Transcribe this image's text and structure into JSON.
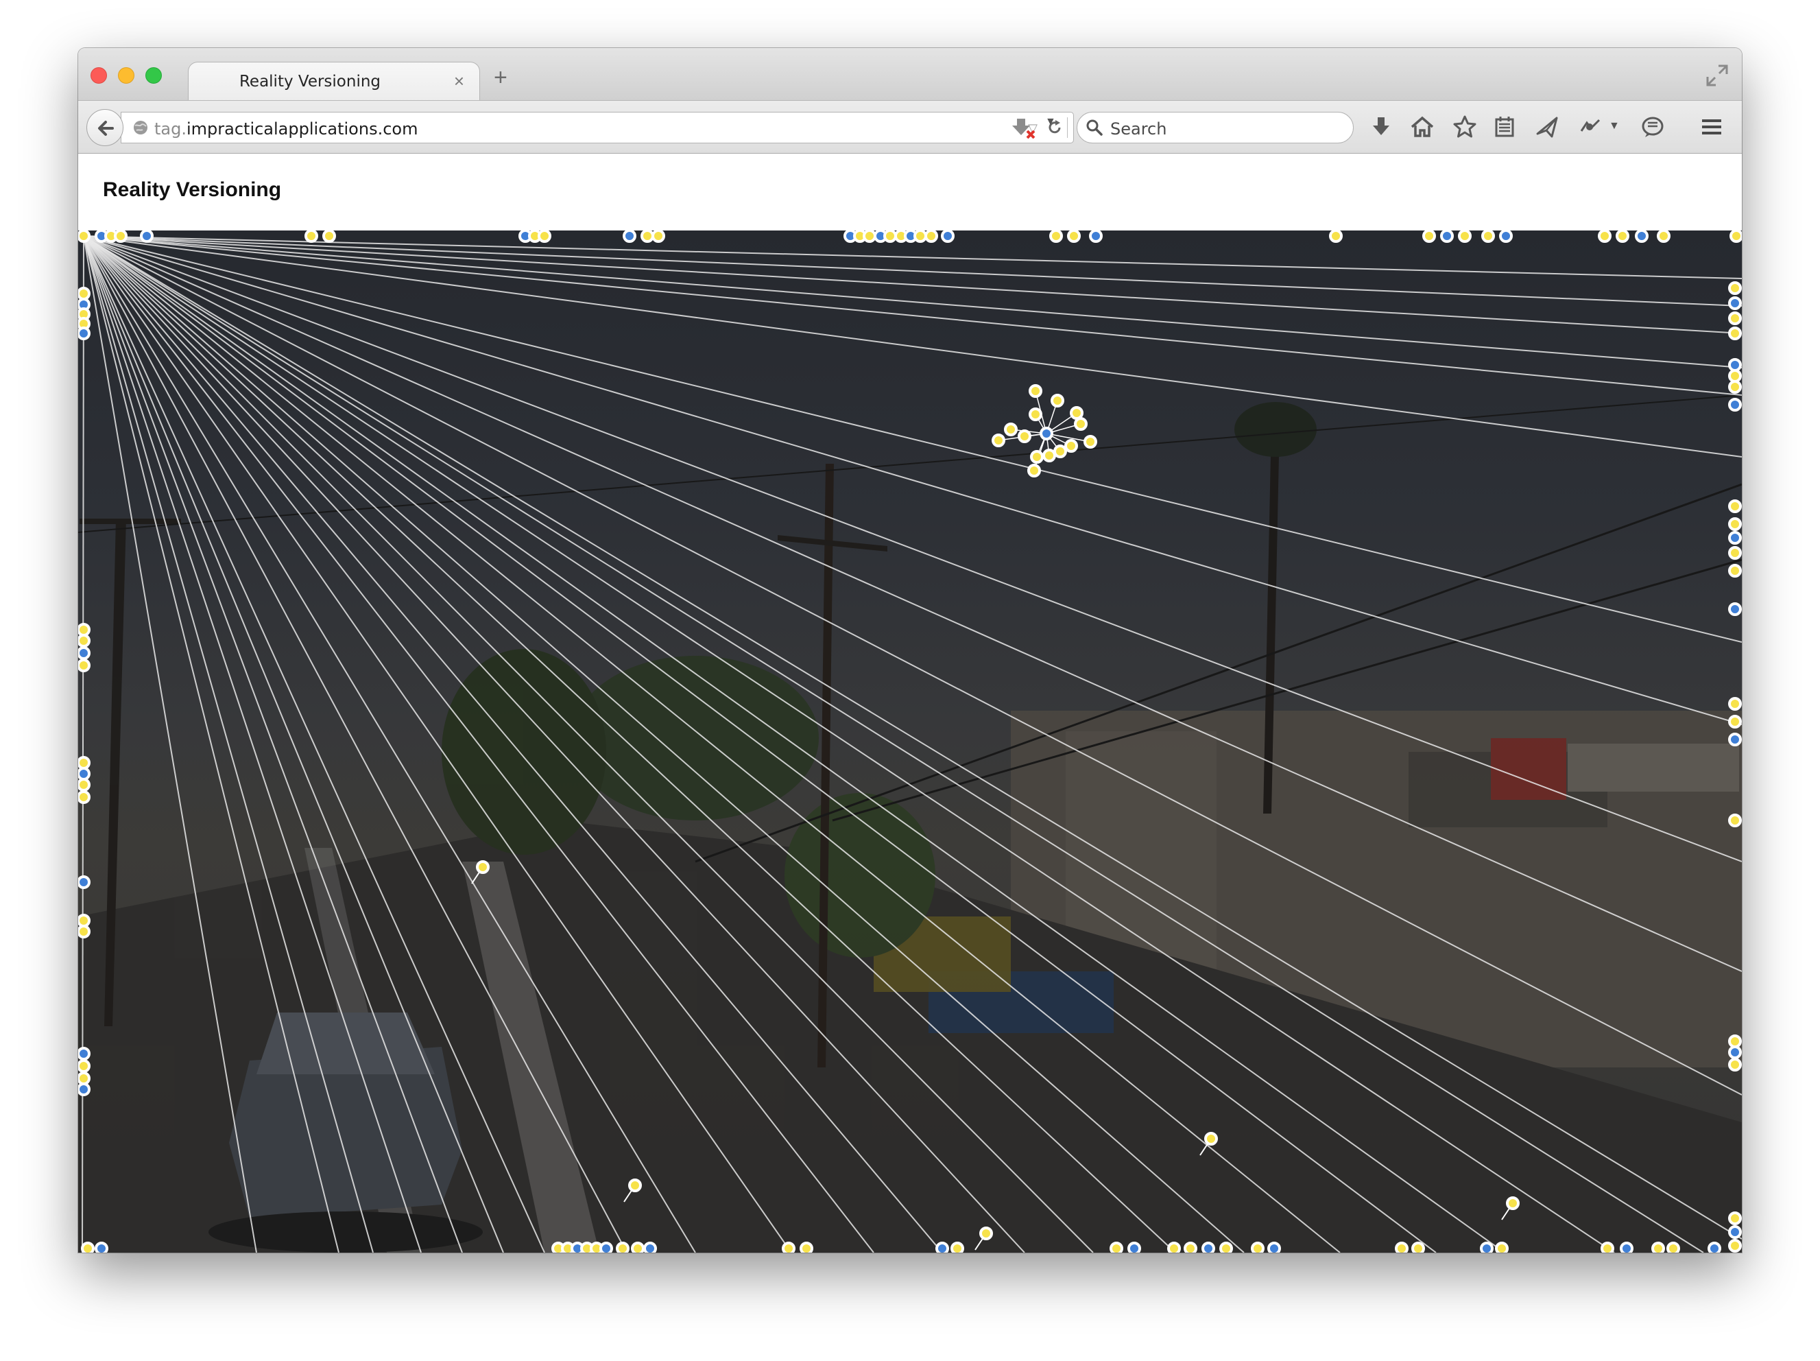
{
  "browser": {
    "tab_title": "Reality Versioning",
    "tab_close_glyph": "×",
    "new_tab_glyph": "+",
    "url_scheme_part": "tag.",
    "url_domain_part": "impracticalapplications.com",
    "search_placeholder": "Search",
    "toolbar_icons": [
      "downloads-icon",
      "home-icon",
      "bookmark-star-icon",
      "reading-list-icon",
      "share-icon",
      "extension-icon",
      "chat-icon",
      "hamburger-menu-icon"
    ]
  },
  "page": {
    "title": "Reality Versioning"
  },
  "scene": {
    "description_icons": [
      "street-view-photo",
      "ray-lines",
      "tag-markers"
    ],
    "colors": {
      "marker_yellow": "#f7e24a",
      "marker_blue": "#3f7fd6",
      "marker_ring": "#ffffff",
      "line_white": "#e8e8e8"
    }
  }
}
